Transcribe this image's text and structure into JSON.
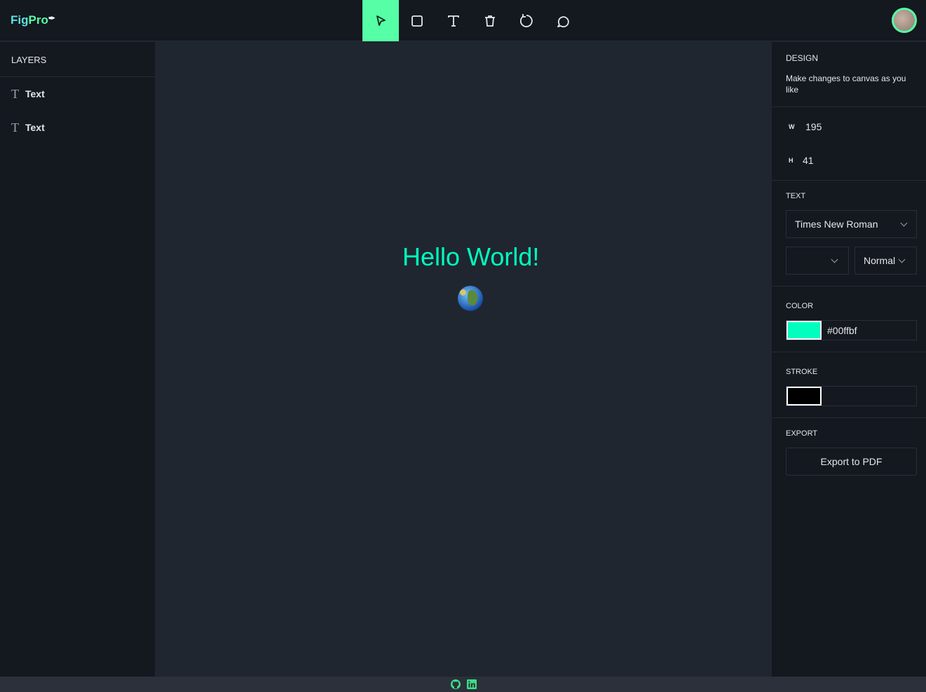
{
  "app": {
    "logo_part1": "Fig",
    "logo_part2": "Pro"
  },
  "toolbar": {
    "tools": [
      "select",
      "rectangle",
      "text",
      "delete",
      "reset",
      "comment"
    ],
    "active": "select",
    "accent": "#56ffa6"
  },
  "layers": {
    "title": "LAYERS",
    "items": [
      {
        "label": "Text"
      },
      {
        "label": "Text"
      }
    ]
  },
  "canvas": {
    "text": "Hello World!",
    "text_color": "#00ffbf",
    "emoji": "🌍"
  },
  "design": {
    "title": "DESIGN",
    "description": "Make changes to canvas as you like",
    "width_label": "W",
    "width": "195",
    "height_label": "H",
    "height": "41",
    "text_title": "TEXT",
    "font_family": "Times New Roman",
    "font_size": "",
    "font_weight": "Normal",
    "color_title": "COLOR",
    "color": "#00ffbf",
    "stroke_title": "STROKE",
    "stroke": "#000000",
    "export_title": "EXPORT",
    "export_label": "Export to PDF"
  },
  "footer": {
    "icons": [
      "github-icon",
      "linkedin-icon"
    ]
  }
}
